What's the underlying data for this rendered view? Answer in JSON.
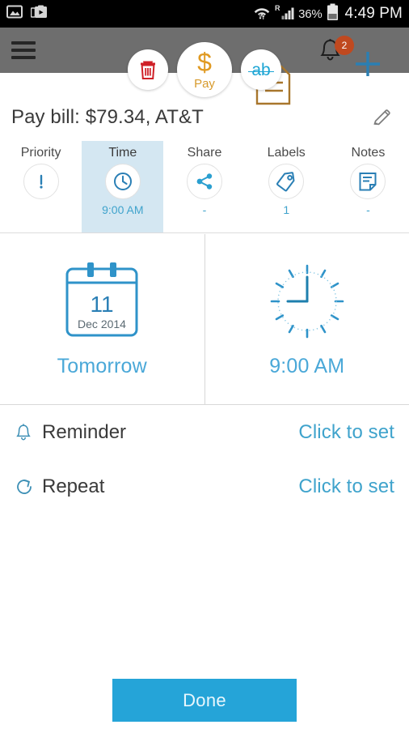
{
  "status_bar": {
    "icons": [
      "image-icon",
      "screenshot-icon"
    ],
    "wifi_icon": "wifi-icon",
    "roaming_label": "R",
    "signal_icon": "signal-bars-icon",
    "battery_percent": "36%",
    "battery_icon": "battery-icon",
    "clock": "4:49 PM"
  },
  "toolbar": {
    "menu_icon": "hamburger-menu-icon",
    "delete_label": "delete-icon",
    "pay_label": "Pay",
    "pay_symbol": "$",
    "ab_label": "ab",
    "note_icon": "note-icon",
    "bell_icon": "bell-icon",
    "notification_count": "2",
    "add_icon": "plus-icon",
    "background_color": "#6e6e6e"
  },
  "title": {
    "text": "Pay bill: $79.34, AT&T",
    "edit_icon": "pencil-icon"
  },
  "tabs": [
    {
      "label": "Priority",
      "icon": "exclamation-icon",
      "sub": "",
      "active": false
    },
    {
      "label": "Time",
      "icon": "clock-icon",
      "sub": "9:00 AM",
      "active": true
    },
    {
      "label": "Share",
      "icon": "share-icon",
      "sub": "-",
      "active": false
    },
    {
      "label": "Labels",
      "icon": "tag-icon",
      "sub": "1",
      "active": false
    },
    {
      "label": "Notes",
      "icon": "note-page-icon",
      "sub": "-",
      "active": false
    }
  ],
  "date_card": {
    "icon": "calendar-icon",
    "day": "11",
    "month_year": "Dec 2014",
    "caption": "Tomorrow"
  },
  "time_card": {
    "icon": "analog-clock-icon",
    "caption": "9:00 AM"
  },
  "options": [
    {
      "icon": "bell-outline-icon",
      "label": "Reminder",
      "action": "Click to set"
    },
    {
      "icon": "repeat-icon",
      "label": "Repeat",
      "action": "Click to set"
    }
  ],
  "footer": {
    "done_label": "Done"
  },
  "colors": {
    "accent_blue": "#25a4d8",
    "light_blue": "#4aa8d8",
    "tab_active_bg": "#d4e7f2",
    "toolbar_gray": "#6e6e6e",
    "badge_orange": "#c0491f",
    "pay_gold": "#d79a2b",
    "delete_red": "#cf2027"
  }
}
